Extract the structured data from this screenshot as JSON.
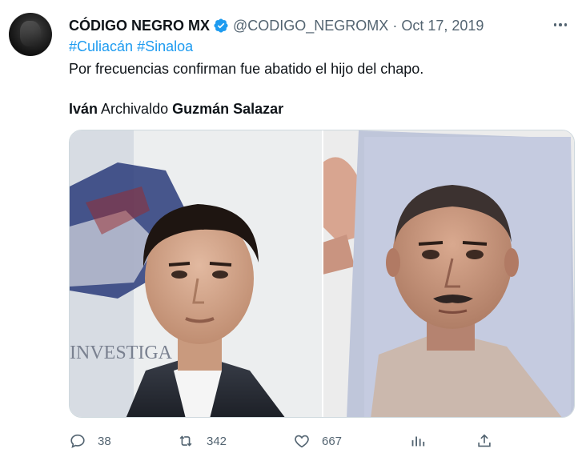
{
  "tweet": {
    "display_name": "CÓDIGO NEGRO MX",
    "handle": "@CODIGO_NEGROMX",
    "separator": "·",
    "date": "Oct 17, 2019",
    "hashtags": [
      "#Culiacán",
      "#Sinaloa"
    ],
    "text": "Por frecuencias confirman fue abatido el hijo del chapo.",
    "name_parts": {
      "first": "Iván",
      "middle": "Archivaldo",
      "last": "Guzmán Salazar"
    },
    "media": {
      "left_photo_text": "INVESTIGA",
      "left_description": "photo of young man in dark suit",
      "right_description": "hand holding printed photo of older man"
    }
  },
  "actions": {
    "reply_count": "38",
    "retweet_count": "342",
    "like_count": "667"
  },
  "icons": {
    "verified": "verified-badge-icon",
    "more": "more-icon",
    "reply": "reply-icon",
    "retweet": "retweet-icon",
    "like": "like-icon",
    "analytics": "analytics-icon",
    "share": "share-icon"
  },
  "colors": {
    "link": "#1d9bf0",
    "text": "#0f1419",
    "secondary": "#536471",
    "verified": "#1d9bf0"
  }
}
